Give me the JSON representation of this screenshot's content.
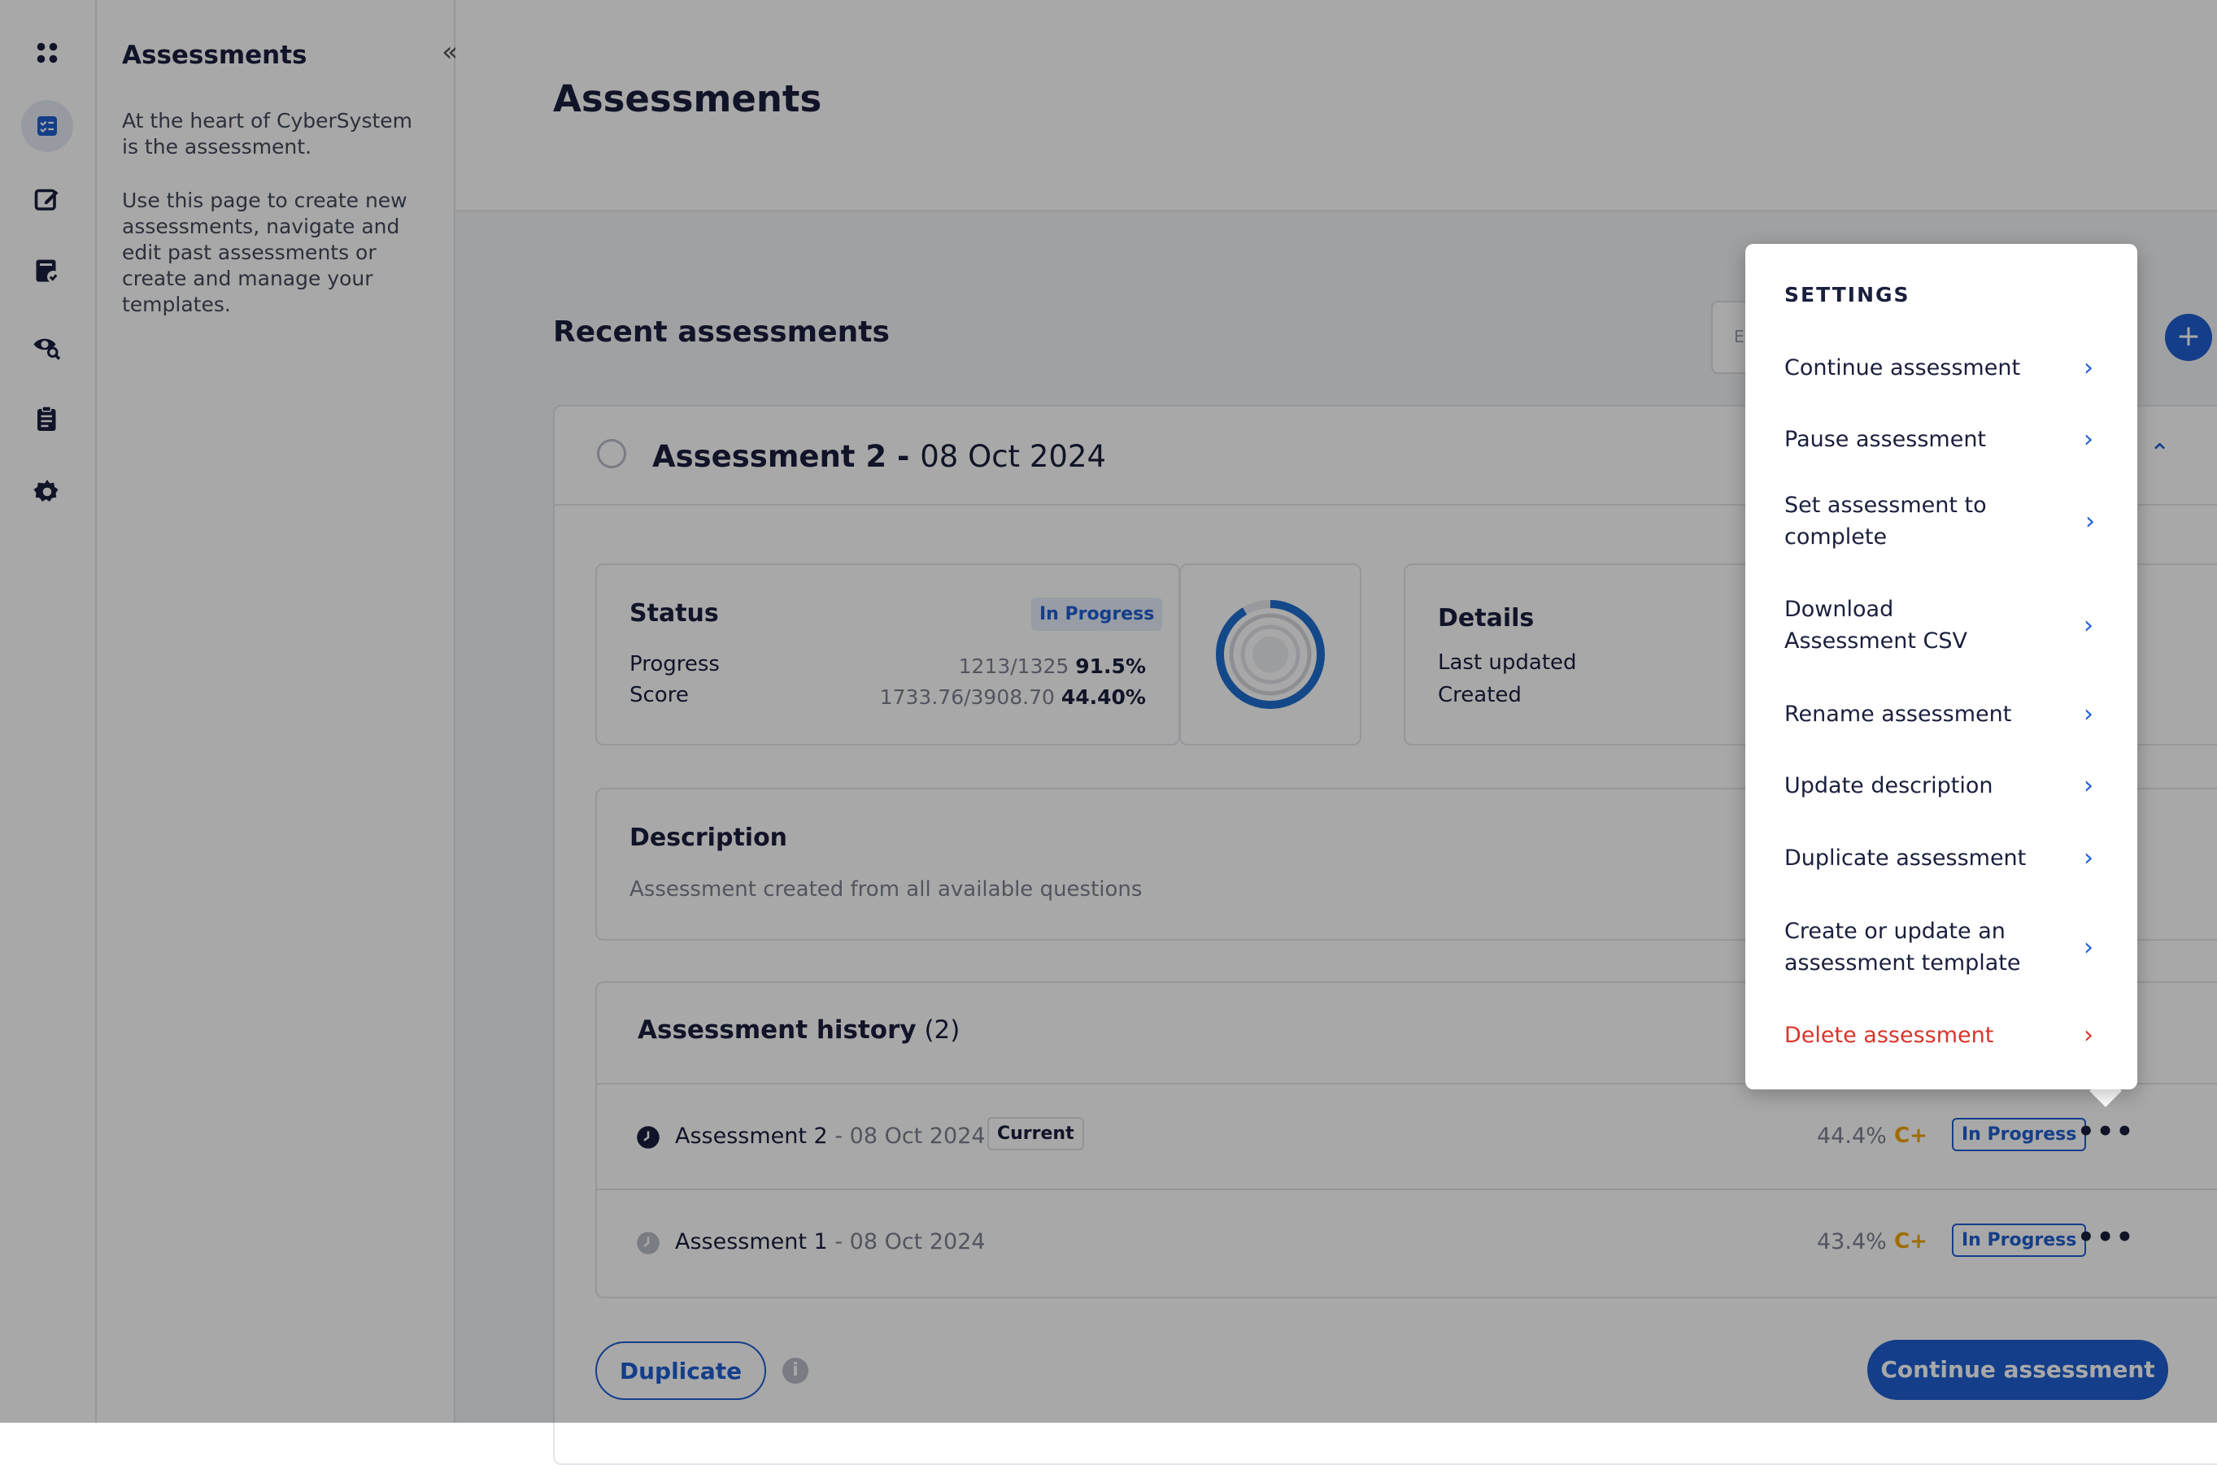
{
  "sidebar": {
    "title": "Assessments",
    "collapse_icon": "«",
    "desc1": "At the heart of CyberSystem is the assessment.",
    "desc2": "Use this page to create new assessments, navigate and edit past assessments or create and manage your templates."
  },
  "page": {
    "title": "Assessments",
    "section_title": "Recent assessments",
    "search_stub": "E"
  },
  "card": {
    "title_bold": "Assessment 2 - ",
    "title_date": "08 Oct 2024",
    "status": {
      "heading": "Status",
      "badge": "In Progress",
      "progress_label": "Progress",
      "progress_count": "1213/1325",
      "progress_pct": "91.5%",
      "score_label": "Score",
      "score_count": "1733.76/3908.70",
      "score_pct": "44.40%"
    },
    "details": {
      "heading": "Details",
      "last_updated": "Last updated",
      "created": "Created"
    },
    "description": {
      "heading": "Description",
      "text": "Assessment created from all available questions"
    },
    "history": {
      "heading": "Assessment history",
      "count": "(2)",
      "rows": [
        {
          "name": "Assessment 2",
          "date": " - 08 Oct 2024",
          "tag": "Current",
          "pct": "44.4%",
          "grade": "C+",
          "status": "In Progress",
          "more": "•••"
        },
        {
          "name": "Assessment 1",
          "date": " - 08 Oct 2024",
          "tag": "",
          "pct": "43.4%",
          "grade": "C+",
          "status": "In Progress",
          "more": "•••"
        }
      ]
    },
    "duplicate_btn": "Duplicate",
    "continue_btn": "Continue assessment",
    "info_glyph": "i"
  },
  "menu": {
    "heading": "SETTINGS",
    "items": [
      "Continue assessment",
      "Pause assessment",
      "Set assessment to complete",
      "Download Assessment CSV",
      "Rename assessment",
      "Update description",
      "Duplicate assessment",
      "Create or update an assessment template",
      "Delete assessment"
    ],
    "chevron": "›"
  },
  "colors": {
    "accent": "#1f5fd1",
    "danger": "#d9342b",
    "grade": "#f0a500"
  },
  "progress_ring": {
    "value": 0.915
  },
  "icons": [
    "grid-icon",
    "checklist-icon",
    "edit-icon",
    "doc-check-icon",
    "eye-search-icon",
    "clipboard-icon",
    "gear-icon"
  ]
}
